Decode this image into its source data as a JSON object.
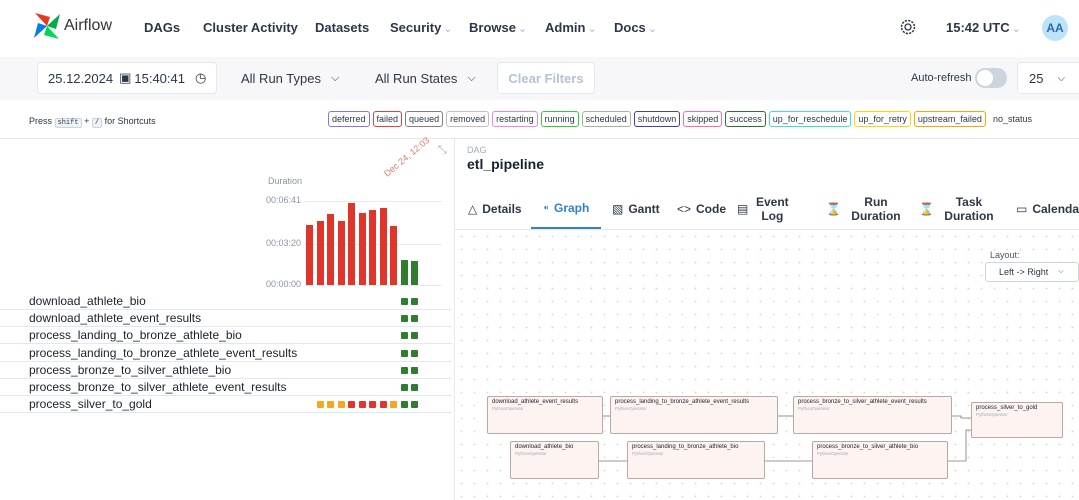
{
  "navbar": {
    "app_name": "Airflow",
    "items": [
      {
        "label": "DAGs",
        "caret": false
      },
      {
        "label": "Cluster Activity",
        "caret": false
      },
      {
        "label": "Datasets",
        "caret": false
      },
      {
        "label": "Security",
        "caret": true
      },
      {
        "label": "Browse",
        "caret": true
      },
      {
        "label": "Admin",
        "caret": true
      },
      {
        "label": "Docs",
        "caret": true
      }
    ],
    "time": "15:42 UTC",
    "avatar": "AA",
    "icons": [
      "airflow-logo-icon",
      "gear-icon"
    ]
  },
  "filters": {
    "date_value": "25.12.2024",
    "time_value": "15:40:41",
    "run_types": "All Run Types",
    "run_states": "All Run States",
    "clear_label": "Clear Filters",
    "autorefresh_label": "Auto-refresh",
    "autorefresh_on": false,
    "num_runs": "25"
  },
  "legend": {
    "press": "Press",
    "key1": "shift",
    "plus": "+",
    "key2": "/",
    "for_shortcuts": "for Shortcuts",
    "states": [
      {
        "label": "deferred",
        "color": "#9370db"
      },
      {
        "label": "failed",
        "color": "#e53e3e"
      },
      {
        "label": "queued",
        "color": "#808080"
      },
      {
        "label": "removed",
        "color": "#c0c0c0"
      },
      {
        "label": "restarting",
        "color": "#ee82ee"
      },
      {
        "label": "running",
        "color": "#32cd32"
      },
      {
        "label": "scheduled",
        "color": "#a5b49e"
      },
      {
        "label": "shutdown",
        "color": "#4b3fa1"
      },
      {
        "label": "skipped",
        "color": "#ff69b4"
      },
      {
        "label": "success",
        "color": "#2f6f2f"
      },
      {
        "label": "up_for_reschedule",
        "color": "#40e0d0"
      },
      {
        "label": "up_for_retry",
        "color": "#ffd700"
      },
      {
        "label": "upstream_failed",
        "color": "#ffa500"
      },
      {
        "label": "no_status",
        "color": null
      }
    ]
  },
  "grid": {
    "duration_title": "Duration",
    "ticks": [
      "00:06:41",
      "00:03:20",
      "00:00:00"
    ],
    "date_label": "Dec 24, 12:03",
    "runs": [
      {
        "duration_fraction": 0.72,
        "state": "failed"
      },
      {
        "duration_fraction": 0.76,
        "state": "failed"
      },
      {
        "duration_fraction": 0.84,
        "state": "failed"
      },
      {
        "duration_fraction": 0.76,
        "state": "failed"
      },
      {
        "duration_fraction": 0.98,
        "state": "failed"
      },
      {
        "duration_fraction": 0.86,
        "state": "failed"
      },
      {
        "duration_fraction": 0.89,
        "state": "failed"
      },
      {
        "duration_fraction": 0.92,
        "state": "failed"
      },
      {
        "duration_fraction": 0.7,
        "state": "failed"
      },
      {
        "duration_fraction": 0.3,
        "state": "success"
      },
      {
        "duration_fraction": 0.28,
        "state": "success"
      }
    ],
    "tasks": [
      {
        "name": "download_athlete_bio",
        "instances": [
          "success",
          "success"
        ]
      },
      {
        "name": "download_athlete_event_results",
        "instances": [
          "success",
          "success"
        ]
      },
      {
        "name": "process_landing_to_bronze_athlete_bio",
        "instances": [
          "success",
          "success"
        ]
      },
      {
        "name": "process_landing_to_bronze_athlete_event_results",
        "instances": [
          "success",
          "success"
        ]
      },
      {
        "name": "process_bronze_to_silver_athlete_bio",
        "instances": [
          "success",
          "success"
        ]
      },
      {
        "name": "process_bronze_to_silver_athlete_event_results",
        "instances": [
          "success",
          "success"
        ]
      },
      {
        "name": "process_silver_to_gold",
        "instances": [
          "upstream_failed",
          "upstream_failed",
          "upstream_failed",
          "failed",
          "failed",
          "failed",
          "failed",
          "upstream_failed",
          "success",
          "success"
        ]
      }
    ],
    "state_colors": {
      "success": "#2f7d2f",
      "failed": "#e0352b",
      "upstream_failed": "#f5a623"
    }
  },
  "dag": {
    "label": "DAG",
    "id": "etl_pipeline"
  },
  "tabs": [
    {
      "label": "Details",
      "icon": "△",
      "icon_name": "warning-icon",
      "active": false
    },
    {
      "label": "Graph",
      "icon": "⁌",
      "icon_name": "graph-icon",
      "active": true
    },
    {
      "label": "Gantt",
      "icon": "▧",
      "icon_name": "gantt-icon",
      "active": false
    },
    {
      "label": "Code",
      "icon": "<>",
      "icon_name": "code-icon",
      "active": false
    },
    {
      "label": "Event Log",
      "icon": "▤",
      "icon_name": "event-log-icon",
      "active": false
    },
    {
      "label": "Run Duration",
      "icon": "⌛",
      "icon_name": "hourglass-icon",
      "active": false
    },
    {
      "label": "Task Duration",
      "icon": "⌛",
      "icon_name": "hourglass-icon",
      "active": false
    },
    {
      "label": "Calendar",
      "icon": "▭",
      "icon_name": "calendar-icon",
      "active": false
    }
  ],
  "graph": {
    "layout_label": "Layout:",
    "layout_value": "Left -> Right",
    "nodes": [
      {
        "name": "download_athlete_event_results",
        "operator": "PythonOperator"
      },
      {
        "name": "process_landing_to_bronze_athlete_event_results",
        "operator": "PythonOperator"
      },
      {
        "name": "process_bronze_to_silver_athlete_event_results",
        "operator": "PythonOperator"
      },
      {
        "name": "process_silver_to_gold",
        "operator": "PythonOperator"
      },
      {
        "name": "download_athlete_bio",
        "operator": "PythonOperator"
      },
      {
        "name": "process_landing_to_bronze_athlete_bio",
        "operator": "PythonOperator"
      },
      {
        "name": "process_bronze_to_silver_athlete_bio",
        "operator": "PythonOperator"
      }
    ]
  }
}
